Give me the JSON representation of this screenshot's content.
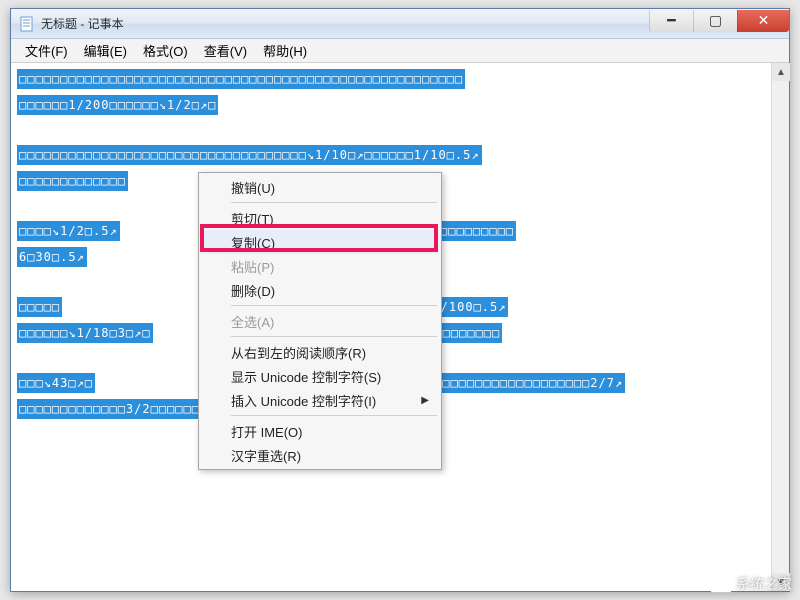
{
  "window": {
    "title": "无标题 - 记事本"
  },
  "menubar": {
    "file": "文件(F)",
    "edit": "编辑(E)",
    "format": "格式(O)",
    "view": "查看(V)",
    "help": "帮助(H)"
  },
  "context_menu": {
    "undo": "撤销(U)",
    "cut": "剪切(T)",
    "copy": "复制(C)",
    "paste": "粘贴(P)",
    "delete": "删除(D)",
    "select_all": "全选(A)",
    "rtl_reading": "从右到左的阅读顺序(R)",
    "show_unicode_ctrl": "显示 Unicode 控制字符(S)",
    "insert_unicode_ctrl": "插入 Unicode 控制字符(I)",
    "open_ime": "打开 IME(O)",
    "hanzi_reselect": "汉字重选(R)"
  },
  "content": {
    "p1": {
      "r1": "□□□□□□□□□□□□□□□□□□□□□□□□□□□□□□□□□□□□□□□□□□□□□□□□□□□□□□",
      "r2": "□□□□□□1/200□□□□□□↘1/2□↗□"
    },
    "p2": {
      "r1": "□□□□□□□□□□□□□□□□□□□□□□□□□□□□□□□□□□□↘1/10□↗□□□□□□1/10□.5↗",
      "r2": "□□□□□□□□□□□□□"
    },
    "p3": {
      "r1": "□□□□↘1/2□.5↗",
      "r1b": "□□□□□□□□□□□□□□□□□□□□□□□□□",
      "r2": "6□30□.5↗"
    },
    "p4": {
      "r1a": "□□□□□",
      "r1b": "□□□□□□□□□□□□□□□↘1/100□.5↗",
      "r2a": "□□□□□□↘1/18□3□↗□",
      "r2b": "□□□□□□□□□□□□□□□□□□□□□□□□□"
    },
    "p5": {
      "r1": "□□□↘43□↗□",
      "r1b": "□□□□□□□□□□□□□□□□□□□□□□□□□□□□□□□□2/7↗",
      "r2": "□□□□□□□□□□□□□3/2□□□□□□□□□□□□□□□□□□□□□"
    }
  },
  "watermark": "系统之家"
}
